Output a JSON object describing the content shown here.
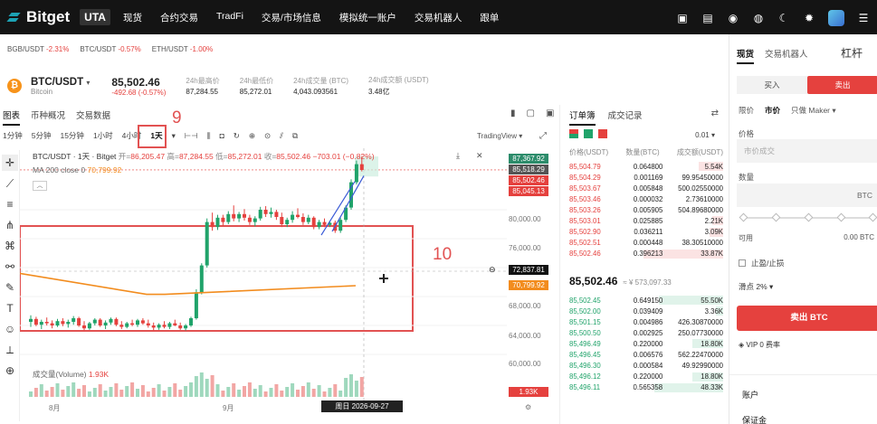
{
  "nav": {
    "logo": "Bitget",
    "badge": "UTA",
    "items": [
      "现货",
      "合约交易",
      "TradFi",
      "交易/市场信息",
      "模拟统一账户",
      "交易机器人",
      "跟单"
    ]
  },
  "tickers": [
    {
      "pair": "BGB/USDT",
      "change": "-2.31%"
    },
    {
      "pair": "BTC/USDT",
      "change": "-0.57%"
    },
    {
      "pair": "ETH/USDT",
      "change": "-1.00%"
    }
  ],
  "pair": {
    "name": "BTC/USDT",
    "sub": "Bitcoin",
    "price": "85,502.46",
    "change": "-492.68 (-0.57%)",
    "stats": [
      {
        "label": "24h最高价",
        "value": "87,284.55"
      },
      {
        "label": "24h最低价",
        "value": "85,272.01"
      },
      {
        "label": "24h成交量 (BTC)",
        "value": "4,043.093561"
      },
      {
        "label": "24h成交额 (USDT)",
        "value": "3.48亿"
      }
    ]
  },
  "chart_tabs": [
    "图表",
    "币种概况",
    "交易数据"
  ],
  "intervals": [
    "1分钟",
    "5分钟",
    "15分钟",
    "1小时",
    "4小时",
    "1天"
  ],
  "tradingview": "TradingView",
  "annotations": {
    "n9": "9",
    "n10": "10"
  },
  "chart_legend": {
    "title": "BTC/USDT · 1天 · Bitget",
    "o_label": "开=",
    "o": "86,205.47",
    "h_label": "高=",
    "h": "87,284.55",
    "l_label": "低=",
    "l": "85,272.01",
    "c_label": "收=",
    "c": "85,502.46",
    "chg": "−703.01 (−0.82%)",
    "ma": "MA 200 close 0",
    "ma_val": "70,799.92",
    "vol_label": "成交量(Volume)",
    "vol_val": "1.93K"
  },
  "price_tags": [
    {
      "label": "87,367.92",
      "bg": "#2c8c6b"
    },
    {
      "label": "85,518.29",
      "bg": "#555555"
    },
    {
      "label": "85,502.46",
      "bg": "#e5413e"
    },
    {
      "label": "85,045.13",
      "bg": "#e5413e"
    }
  ],
  "crosshair_tag": "72,837.81",
  "ma_tag": "70,799.92",
  "vol_tag": "1.93K",
  "x_labels": [
    "8月",
    "9月"
  ],
  "date_tag": "周日 2026-09-27",
  "chart_data": {
    "type": "candlestick",
    "y_ticks": [
      "80,000.00",
      "76,000.00",
      "72,000.00",
      "68,000.00",
      "64,000.00",
      "60,000.00"
    ],
    "ylim": [
      58500,
      88500
    ],
    "candles": [
      [
        64500,
        65400,
        63800,
        64900
      ],
      [
        64900,
        65200,
        63900,
        64100
      ],
      [
        64100,
        64800,
        63500,
        64500
      ],
      [
        64500,
        65100,
        64000,
        64300
      ],
      [
        64300,
        64700,
        63600,
        64000
      ],
      [
        64000,
        64900,
        63800,
        64600
      ],
      [
        64600,
        65000,
        63900,
        64200
      ],
      [
        64200,
        64800,
        63700,
        64500
      ],
      [
        64500,
        65300,
        64100,
        65000
      ],
      [
        65000,
        65200,
        63800,
        64000
      ],
      [
        64000,
        64600,
        63300,
        63600
      ],
      [
        63600,
        64500,
        63400,
        64300
      ],
      [
        64300,
        65000,
        64000,
        64800
      ],
      [
        64800,
        65000,
        63800,
        64000
      ],
      [
        64000,
        64700,
        63500,
        64400
      ],
      [
        64400,
        65100,
        64100,
        64900
      ],
      [
        64900,
        65100,
        63900,
        64100
      ],
      [
        64100,
        64600,
        63500,
        63800
      ],
      [
        63800,
        64500,
        63600,
        64300
      ],
      [
        64300,
        64800,
        63900,
        64100
      ],
      [
        64100,
        64900,
        63800,
        64700
      ],
      [
        64700,
        65000,
        64100,
        64300
      ],
      [
        64300,
        64800,
        63700,
        64000
      ],
      [
        64000,
        64400,
        63300,
        63700
      ],
      [
        63700,
        64300,
        63400,
        64100
      ],
      [
        64100,
        64600,
        63600,
        63800
      ],
      [
        63800,
        64500,
        63500,
        64300
      ],
      [
        64300,
        64800,
        63900,
        64000
      ],
      [
        64000,
        64400,
        63400,
        63600
      ],
      [
        63600,
        64200,
        63300,
        64000
      ],
      [
        64000,
        65200,
        63800,
        65000
      ],
      [
        65000,
        69000,
        64800,
        68600
      ],
      [
        68600,
        72600,
        68300,
        72300
      ],
      [
        72300,
        78800,
        72000,
        78300
      ],
      [
        78300,
        79600,
        77100,
        77600
      ],
      [
        77600,
        79300,
        77200,
        78900
      ],
      [
        78900,
        79300,
        77800,
        78300
      ],
      [
        78300,
        79800,
        78000,
        79400
      ],
      [
        79400,
        80600,
        78400,
        78800
      ],
      [
        78800,
        79700,
        78300,
        79400
      ],
      [
        79400,
        80100,
        78500,
        78900
      ],
      [
        78900,
        79300,
        77900,
        78300
      ],
      [
        78300,
        79100,
        77700,
        78800
      ],
      [
        78800,
        80400,
        78500,
        80000
      ],
      [
        80000,
        80500,
        79000,
        79400
      ],
      [
        79400,
        80300,
        78900,
        79700
      ],
      [
        79700,
        80000,
        78600,
        79000
      ],
      [
        79000,
        79600,
        77600,
        78000
      ],
      [
        78000,
        78900,
        77600,
        78600
      ],
      [
        78600,
        79800,
        78200,
        79300
      ],
      [
        79300,
        80200,
        78800,
        79000
      ],
      [
        79000,
        79500,
        77900,
        78300
      ],
      [
        78300,
        79300,
        78000,
        78900
      ],
      [
        78900,
        79100,
        77300,
        77600
      ],
      [
        77600,
        78600,
        77300,
        78300
      ],
      [
        78300,
        78800,
        77600,
        77900
      ],
      [
        77900,
        78500,
        77600,
        78200
      ],
      [
        78200,
        78500,
        76800,
        77100
      ],
      [
        77100,
        78900,
        76800,
        78600
      ],
      [
        78600,
        80600,
        78300,
        80300
      ],
      [
        80300,
        84200,
        80000,
        83800
      ],
      [
        83800,
        86800,
        83500,
        86300
      ],
      [
        86300,
        87400,
        85300,
        85500
      ]
    ],
    "ma200": [
      [
        0,
        71200
      ],
      [
        140,
        68300
      ],
      [
        160,
        68300
      ],
      [
        371,
        69500
      ]
    ],
    "trend_lines": [
      [
        [
          333,
          76500
        ],
        [
          370,
          83900
        ]
      ],
      [
        [
          345,
          77000
        ],
        [
          380,
          84700
        ]
      ]
    ]
  },
  "orderbook": {
    "tabs": [
      "订单簿",
      "成交记录"
    ],
    "precision": "0.01",
    "headers": [
      "价格(USDT)",
      "数量(BTC)",
      "成交额(USDT)"
    ],
    "asks": [
      [
        "85,504.79",
        "0.064800",
        "5.54K",
        0.16
      ],
      [
        "85,504.29",
        "0.001169",
        "99.95450000",
        0.0
      ],
      [
        "85,503.67",
        "0.005848",
        "500.02550000",
        0.0
      ],
      [
        "85,503.46",
        "0.000032",
        "2.73610000",
        0.0
      ],
      [
        "85,503.26",
        "0.005905",
        "504.89680000",
        0.0
      ],
      [
        "85,503.01",
        "0.025885",
        "2.21K",
        0.07
      ],
      [
        "85,502.90",
        "0.036211",
        "3.09K",
        0.09
      ],
      [
        "85,502.51",
        "0.000448",
        "38.30510000",
        0.0
      ],
      [
        "85,502.46",
        "0.396213",
        "33.87K",
        0.52
      ]
    ],
    "mid_price": "85,502.46",
    "mid_usd": "≈ ¥ 573,097.33",
    "bids": [
      [
        "85,502.45",
        "0.649150",
        "55.50K",
        0.42
      ],
      [
        "85,502.00",
        "0.039409",
        "3.36K",
        0.05
      ],
      [
        "85,501.15",
        "0.004986",
        "426.30870000",
        0.0
      ],
      [
        "85,500.50",
        "0.002925",
        "250.07730000",
        0.0
      ],
      [
        "85,496.49",
        "0.220000",
        "18.80K",
        0.2
      ],
      [
        "85,496.45",
        "0.006576",
        "562.22470000",
        0.0
      ],
      [
        "85,496.30",
        "0.000584",
        "49.92990000",
        0.0
      ],
      [
        "85,496.12",
        "0.220000",
        "18.80K",
        0.2
      ],
      [
        "85,496.11",
        "0.565358",
        "48.33K",
        0.45
      ]
    ]
  },
  "order_panel": {
    "tabs": [
      "现货",
      "交易机器人"
    ],
    "leverage": "杠杆",
    "buy": "买入",
    "sell": "卖出",
    "types": [
      "限价",
      "市价",
      "只做 Maker"
    ],
    "price_label": "价格",
    "price_placeholder": "市价成交",
    "qty_label": "数量",
    "qty_unit": "BTC",
    "avail_label": "可用",
    "avail_value": "0.00 BTC",
    "tpsl": "止盈/止损",
    "slippage": "滑点 2%",
    "sell_btn": "卖出 BTC",
    "vip": "VIP 0 费率",
    "account": "账户",
    "margin": "保证金"
  }
}
